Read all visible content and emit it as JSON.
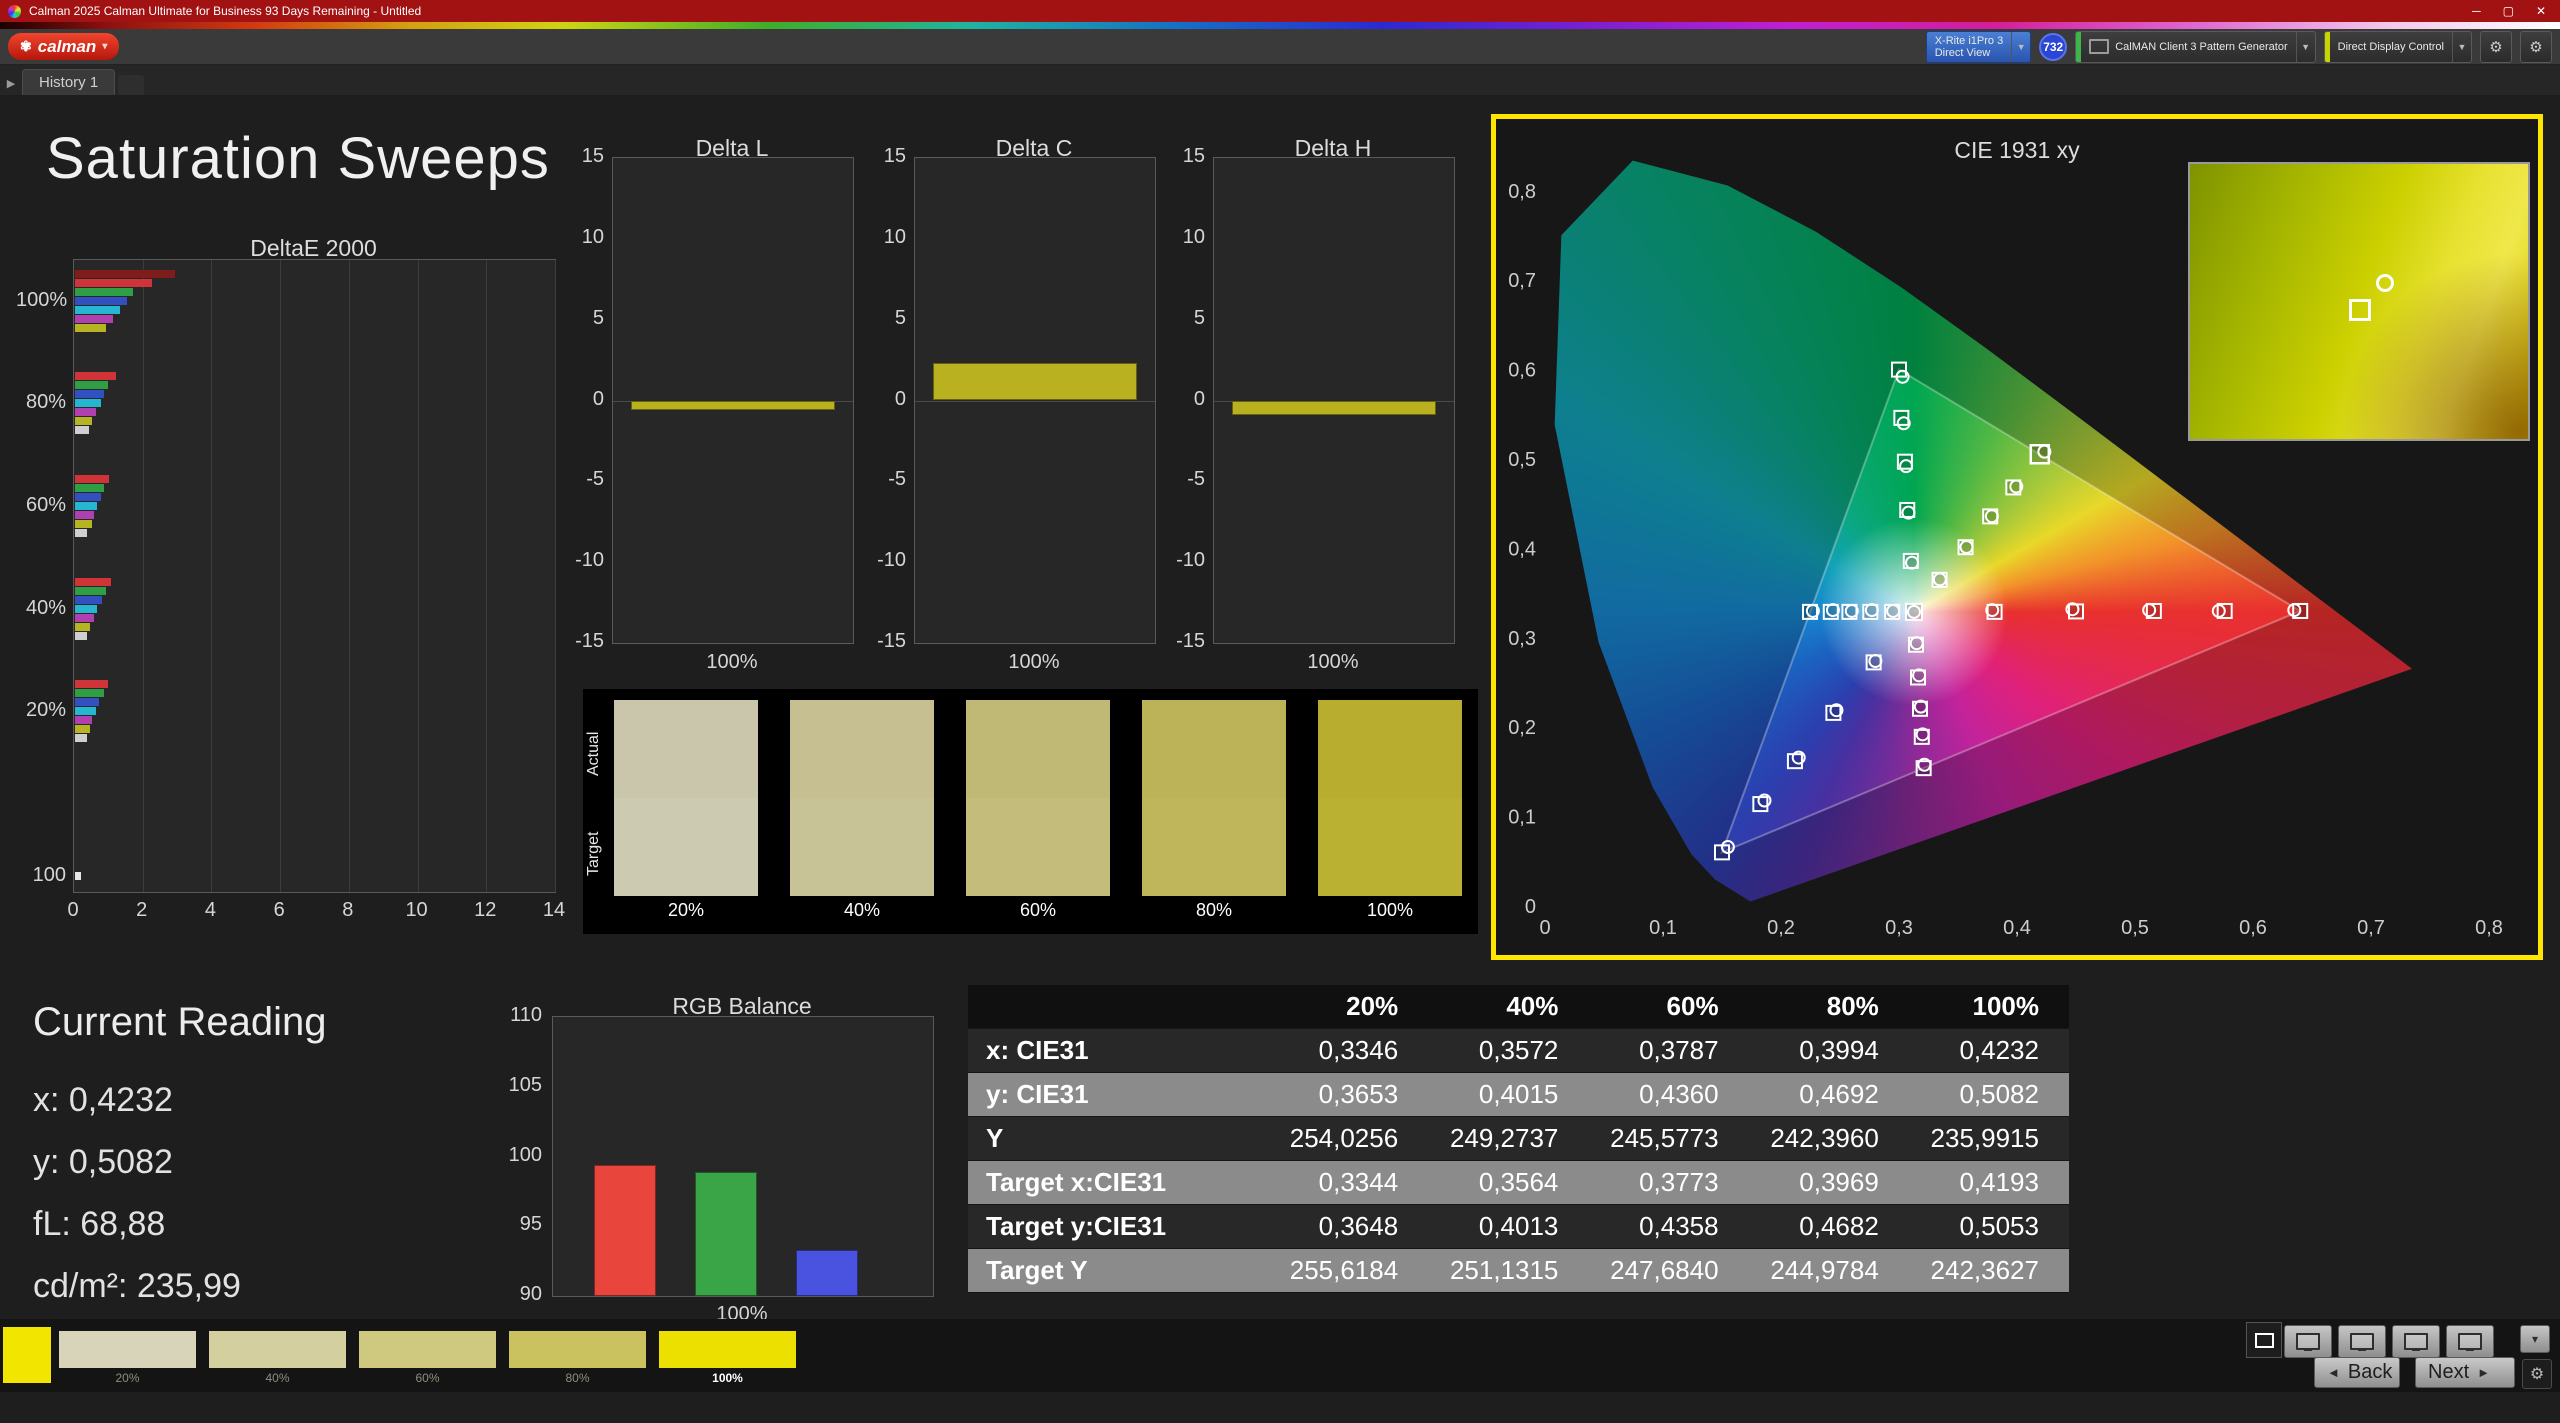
{
  "window": {
    "title": "Calman 2025 Calman Ultimate for Business 93 Days Remaining - Untitled",
    "controls": {
      "minimize": "─",
      "maximize": "▢",
      "close": "✕"
    }
  },
  "appbar": {
    "logo_text": "calman",
    "logo_caret": "▾",
    "meter": {
      "line1": "X-Rite i1Pro 3",
      "line2": "Direct View"
    },
    "badge": "732",
    "pattern_generator": "CalMAN Client 3 Pattern Generator",
    "display_control": "Direct Display Control"
  },
  "tabbar": {
    "tab": "History 1"
  },
  "page_title": "Saturation Sweeps",
  "current_reading": {
    "title": "Current Reading",
    "lines": [
      "x: 0,4232",
      "y: 0,5082",
      "fL: 68,88",
      "cd/m²: 235,99"
    ]
  },
  "swatch_strip": {
    "row_labels": [
      "Actual",
      "Target"
    ],
    "labels": [
      "20%",
      "40%",
      "60%",
      "80%",
      "100%"
    ],
    "actual_colors": [
      "#c9c6ac",
      "#c5bf92",
      "#c0b975",
      "#bcb258",
      "#b8ad2e"
    ],
    "target_colors": [
      "#cccab1",
      "#c8c297",
      "#c3bc7a",
      "#bfb55b",
      "#bab031"
    ]
  },
  "table": {
    "columns": [
      "",
      "20%",
      "40%",
      "60%",
      "80%",
      "100%"
    ],
    "rows": [
      {
        "label": "x: CIE31",
        "values": [
          "0,3346",
          "0,3572",
          "0,3787",
          "0,3994",
          "0,4232"
        ],
        "shade": "dark"
      },
      {
        "label": "y: CIE31",
        "values": [
          "0,3653",
          "0,4015",
          "0,4360",
          "0,4692",
          "0,5082"
        ],
        "shade": "gray"
      },
      {
        "label": "Y",
        "values": [
          "254,0256",
          "249,2737",
          "245,5773",
          "242,3960",
          "235,9915"
        ],
        "shade": "dark"
      },
      {
        "label": "Target x:CIE31",
        "values": [
          "0,3344",
          "0,3564",
          "0,3773",
          "0,3969",
          "0,4193"
        ],
        "shade": "gray"
      },
      {
        "label": "Target y:CIE31",
        "values": [
          "0,3648",
          "0,4013",
          "0,4358",
          "0,4682",
          "0,5053"
        ],
        "shade": "dark"
      },
      {
        "label": "Target Y",
        "values": [
          "255,6184",
          "251,1315",
          "247,6840",
          "244,9784",
          "242,3627"
        ],
        "shade": "gray"
      }
    ]
  },
  "bottom_bar": {
    "patch_color": "#f2e600",
    "swatches": [
      {
        "label": "20%",
        "color": "#d8d4b9",
        "selected": false
      },
      {
        "label": "40%",
        "color": "#d4cf9e",
        "selected": false
      },
      {
        "label": "60%",
        "color": "#cfc87f",
        "selected": false
      },
      {
        "label": "80%",
        "color": "#cac25f",
        "selected": false
      },
      {
        "label": "100%",
        "color": "#ece000",
        "selected": true
      }
    ],
    "back_label": "Back",
    "next_label": "Next"
  },
  "chart_data": [
    {
      "name": "deltae2000",
      "type": "bar",
      "orientation": "horizontal",
      "title": "DeltaE 2000",
      "xlim": [
        0,
        14
      ],
      "xticks": [
        "0",
        "2",
        "4",
        "6",
        "8",
        "10",
        "12",
        "14"
      ],
      "groups": [
        {
          "label": "100%",
          "bars": [
            {
              "color": "#7f1d1d",
              "value": 2.9
            },
            {
              "color": "#d13438",
              "value": 2.25
            },
            {
              "color": "#2f9e44",
              "value": 1.7
            },
            {
              "color": "#3350c0",
              "value": 1.5
            },
            {
              "color": "#25b6d2",
              "value": 1.3
            },
            {
              "color": "#b03fb0",
              "value": 1.1
            },
            {
              "color": "#b5b423",
              "value": 0.9
            }
          ]
        },
        {
          "label": "80%",
          "bars": [
            {
              "color": "#d13438",
              "value": 1.2
            },
            {
              "color": "#2f9e44",
              "value": 0.95
            },
            {
              "color": "#3350c0",
              "value": 0.85
            },
            {
              "color": "#25b6d2",
              "value": 0.75
            },
            {
              "color": "#b03fb0",
              "value": 0.6
            },
            {
              "color": "#b5b423",
              "value": 0.5
            },
            {
              "color": "#cfcfcf",
              "value": 0.4
            }
          ]
        },
        {
          "label": "60%",
          "bars": [
            {
              "color": "#d13438",
              "value": 1.0
            },
            {
              "color": "#2f9e44",
              "value": 0.85
            },
            {
              "color": "#3350c0",
              "value": 0.75
            },
            {
              "color": "#25b6d2",
              "value": 0.65
            },
            {
              "color": "#b03fb0",
              "value": 0.55
            },
            {
              "color": "#b5b423",
              "value": 0.5
            },
            {
              "color": "#cfcfcf",
              "value": 0.35
            }
          ]
        },
        {
          "label": "40%",
          "bars": [
            {
              "color": "#d13438",
              "value": 1.05
            },
            {
              "color": "#2f9e44",
              "value": 0.9
            },
            {
              "color": "#3350c0",
              "value": 0.8
            },
            {
              "color": "#25b6d2",
              "value": 0.65
            },
            {
              "color": "#b03fb0",
              "value": 0.55
            },
            {
              "color": "#b5b423",
              "value": 0.45
            },
            {
              "color": "#cfcfcf",
              "value": 0.35
            }
          ]
        },
        {
          "label": "20%",
          "bars": [
            {
              "color": "#d13438",
              "value": 0.95
            },
            {
              "color": "#2f9e44",
              "value": 0.85
            },
            {
              "color": "#3350c0",
              "value": 0.7
            },
            {
              "color": "#25b6d2",
              "value": 0.6
            },
            {
              "color": "#b03fb0",
              "value": 0.5
            },
            {
              "color": "#b5b423",
              "value": 0.45
            },
            {
              "color": "#cfcfcf",
              "value": 0.35
            }
          ]
        },
        {
          "label": "100",
          "bars": [
            {
              "color": "#e8e8e8",
              "value": 0.18
            }
          ]
        }
      ]
    },
    {
      "name": "delta_l",
      "type": "bar",
      "title": "Delta L",
      "ylim": [
        -15,
        15
      ],
      "yticks": [
        "15",
        "10",
        "5",
        "0",
        "-5",
        "-10",
        "-15"
      ],
      "xlabel": "100%",
      "value": -0.6,
      "color": "#b9b120"
    },
    {
      "name": "delta_c",
      "type": "bar",
      "title": "Delta C",
      "ylim": [
        -15,
        15
      ],
      "yticks": [
        "15",
        "10",
        "5",
        "0",
        "-5",
        "-10",
        "-15"
      ],
      "xlabel": "100%",
      "value": 2.3,
      "color": "#b9b120"
    },
    {
      "name": "delta_h",
      "type": "bar",
      "title": "Delta H",
      "ylim": [
        -15,
        15
      ],
      "yticks": [
        "15",
        "10",
        "5",
        "0",
        "-5",
        "-10",
        "-15"
      ],
      "xlabel": "100%",
      "value": -0.9,
      "color": "#b9b120"
    },
    {
      "name": "rgb_balance",
      "type": "bar",
      "title": "RGB Balance",
      "ylim": [
        90,
        110
      ],
      "yticks": [
        "110",
        "105",
        "100",
        "95",
        "90"
      ],
      "xlabel": "100%",
      "series": [
        {
          "name": "red",
          "value": 99.4,
          "color": "#e8453c"
        },
        {
          "name": "green",
          "value": 98.9,
          "color": "#3aa546"
        },
        {
          "name": "blue",
          "value": 93.3,
          "color": "#4a52e0"
        }
      ]
    },
    {
      "name": "cie1931",
      "type": "scatter",
      "title": "CIE 1931 xy",
      "xlim": [
        0,
        0.8
      ],
      "ylim": [
        0,
        0.8
      ],
      "xticks": [
        "0",
        "0,1",
        "0,2",
        "0,3",
        "0,4",
        "0,5",
        "0,6",
        "0,7",
        "0,8"
      ],
      "yticks": [
        "0,8",
        "0,7",
        "0,6",
        "0,5",
        "0,4",
        "0,3",
        "0,2",
        "0,1",
        "0"
      ],
      "white_point": [
        0.3127,
        0.329
      ],
      "triangle": {
        "r": [
          0.64,
          0.33
        ],
        "g": [
          0.3,
          0.6
        ],
        "b": [
          0.15,
          0.06
        ]
      },
      "sweeps": [
        {
          "name": "red",
          "targets": [
            [
              0.381,
              0.329
            ],
            [
              0.45,
              0.3295
            ],
            [
              0.516,
              0.33
            ],
            [
              0.576,
              0.33
            ],
            [
              0.64,
              0.33
            ]
          ],
          "measured": [
            [
              0.379,
              0.331
            ],
            [
              0.447,
              0.332
            ],
            [
              0.512,
              0.331
            ],
            [
              0.571,
              0.33
            ],
            [
              0.635,
              0.331
            ]
          ]
        },
        {
          "name": "green",
          "targets": [
            [
              0.31,
              0.386
            ],
            [
              0.307,
              0.443
            ],
            [
              0.305,
              0.497
            ],
            [
              0.302,
              0.546
            ],
            [
              0.3,
              0.6
            ]
          ],
          "measured": [
            [
              0.311,
              0.384
            ],
            [
              0.308,
              0.44
            ],
            [
              0.306,
              0.492
            ],
            [
              0.304,
              0.54
            ],
            [
              0.303,
              0.592
            ]
          ]
        },
        {
          "name": "blue",
          "targets": [
            [
              0.2785,
              0.2725
            ],
            [
              0.2444,
              0.216
            ],
            [
              0.2118,
              0.162
            ],
            [
              0.1825,
              0.114
            ],
            [
              0.15,
              0.06
            ]
          ],
          "measured": [
            [
              0.28,
              0.274
            ],
            [
              0.247,
              0.219
            ],
            [
              0.215,
              0.166
            ],
            [
              0.186,
              0.118
            ],
            [
              0.155,
              0.066
            ]
          ]
        },
        {
          "name": "cyan",
          "targets": [
            [
              0.2942,
              0.329
            ],
            [
              0.2757,
              0.329
            ],
            [
              0.258,
              0.329
            ],
            [
              0.2422,
              0.329
            ],
            [
              0.2246,
              0.329
            ]
          ],
          "measured": [
            [
              0.295,
              0.33
            ],
            [
              0.277,
              0.331
            ],
            [
              0.26,
              0.33
            ],
            [
              0.244,
              0.331
            ],
            [
              0.227,
              0.33
            ]
          ]
        },
        {
          "name": "magenta",
          "targets": [
            [
              0.3144,
              0.2923
            ],
            [
              0.3161,
              0.2556
            ],
            [
              0.3178,
              0.2206
            ],
            [
              0.3193,
              0.1892
            ],
            [
              0.3209,
              0.1542
            ]
          ],
          "measured": [
            [
              0.315,
              0.294
            ],
            [
              0.317,
              0.258
            ],
            [
              0.3185,
              0.223
            ],
            [
              0.32,
              0.192
            ],
            [
              0.3215,
              0.158
            ]
          ]
        },
        {
          "name": "yellow",
          "targets": [
            [
              0.3344,
              0.3648
            ],
            [
              0.3564,
              0.4013
            ],
            [
              0.3773,
              0.4358
            ],
            [
              0.3969,
              0.4682
            ],
            [
              0.4193,
              0.5053
            ]
          ],
          "measured": [
            [
              0.3346,
              0.3653
            ],
            [
              0.3572,
              0.4015
            ],
            [
              0.3787,
              0.436
            ],
            [
              0.3994,
              0.4692
            ],
            [
              0.4232,
              0.5082
            ]
          ]
        }
      ]
    }
  ]
}
